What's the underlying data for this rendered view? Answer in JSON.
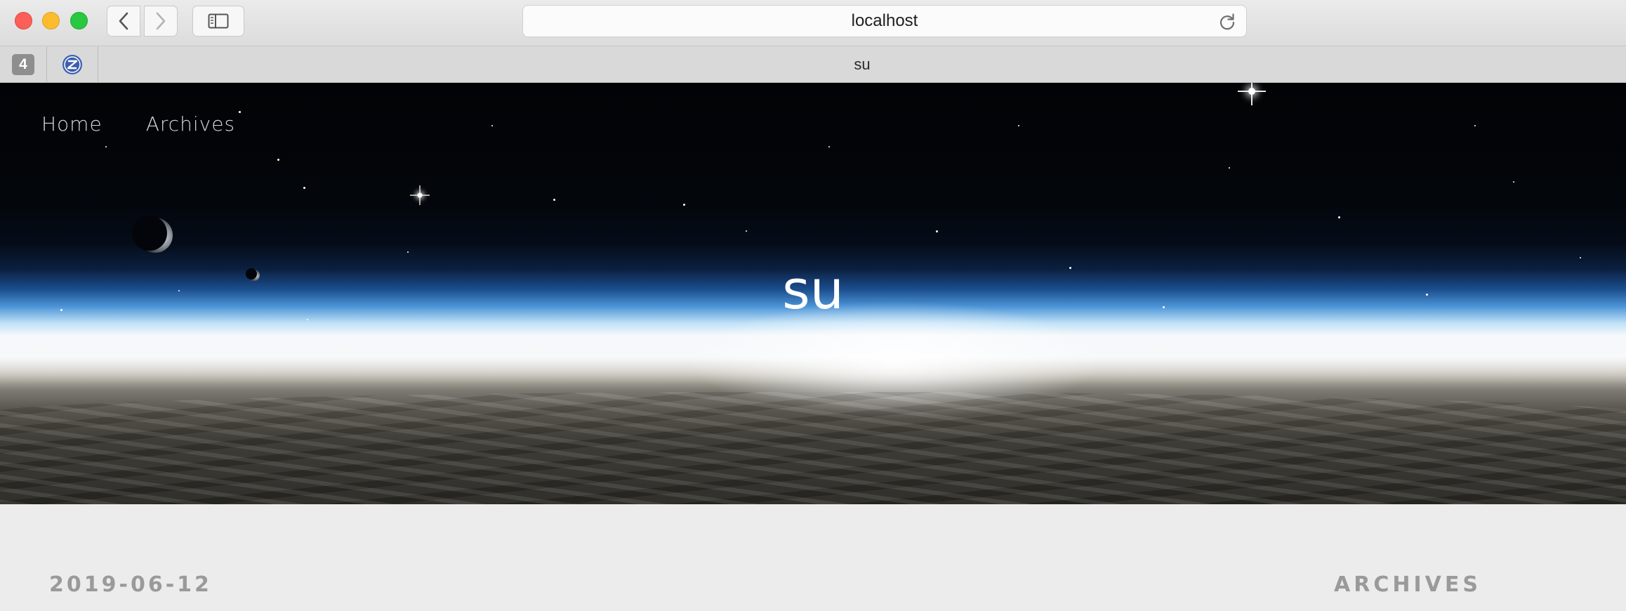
{
  "browser": {
    "url": "localhost",
    "tab_count": "4",
    "tab_title": "su",
    "colors": {
      "close": "#fc5f57",
      "minimize": "#fdbc2e",
      "maximize": "#28c840"
    }
  },
  "site": {
    "nav": [
      "Home",
      "Archives"
    ],
    "hero_title": "su"
  },
  "content": {
    "post_date": "2019-06-12",
    "sidebar_heading": "ARCHIVES"
  },
  "icons": {
    "back": "chevron-left-icon",
    "forward": "chevron-right-icon",
    "sidebar": "sidebar-icon",
    "reload": "reload-icon",
    "favicon": "site-favicon-icon"
  }
}
